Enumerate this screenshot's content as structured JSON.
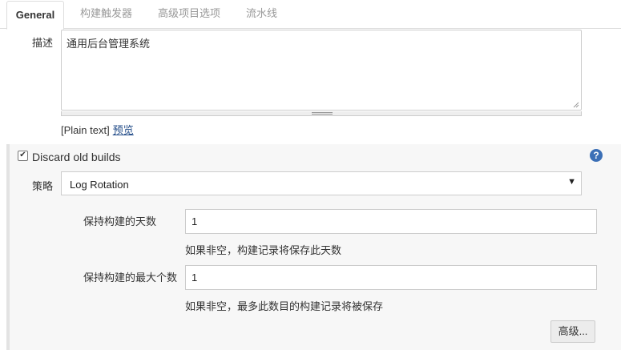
{
  "tabs": [
    {
      "label": "General"
    },
    {
      "label": "构建触发器"
    },
    {
      "label": "高级项目选项"
    },
    {
      "label": "流水线"
    }
  ],
  "description": {
    "label": "描述",
    "value": "通用后台管理系统",
    "format_text": "[Plain text]",
    "preview_link": "预览"
  },
  "discard_builds": {
    "checked": true,
    "label": "Discard old builds",
    "help_icon": "question-circle-icon",
    "strategy_label": "策略",
    "strategy_value": "Log Rotation",
    "days_label": "保持构建的天数",
    "days_value": "1",
    "days_hint": "如果非空，构建记录将保存此天数",
    "max_label": "保持构建的最大个数",
    "max_value": "1",
    "max_hint": "如果非空，最多此数目的构建记录将被保存",
    "advanced_button": "高级..."
  },
  "colors": {
    "link": "#204a87",
    "help_icon": "#3b6fb6",
    "section_bg": "#f7f7f7"
  }
}
